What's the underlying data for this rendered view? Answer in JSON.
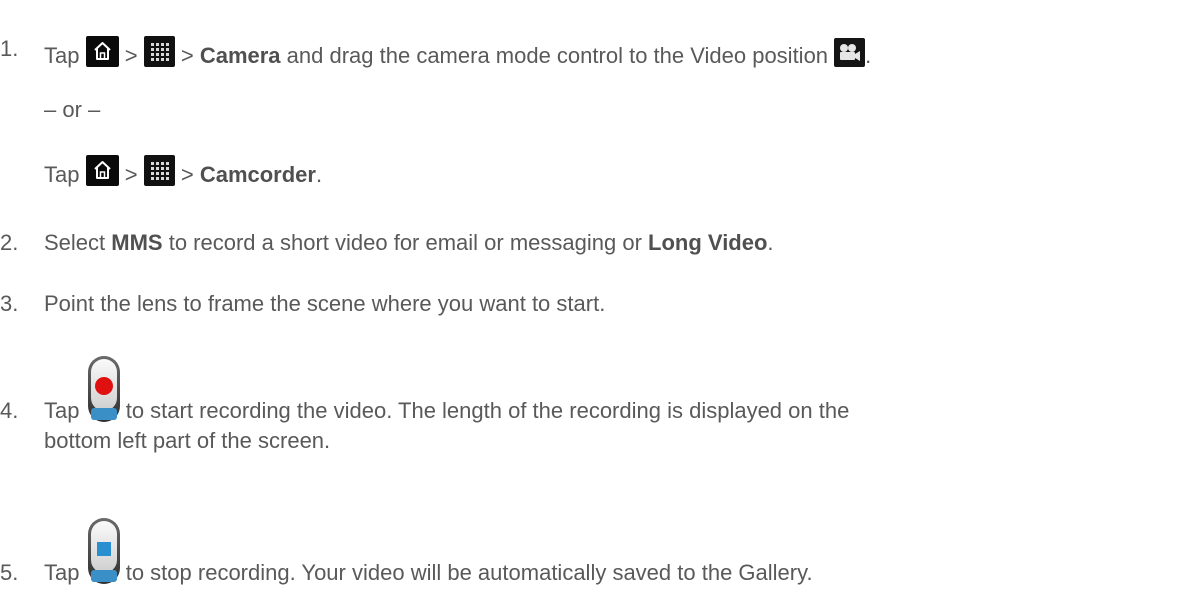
{
  "steps": [
    {
      "number": "1.",
      "t1": "Tap",
      "gt1": ">",
      "gt2": ">",
      "bold": "Camera",
      "t2": " and drag the camera mode control to the Video position",
      "end": "."
    },
    {
      "or": "– or –"
    },
    {
      "t1": "Tap",
      "gt1": ">",
      "gt2": ">",
      "bold": "Camcorder",
      "end": "."
    },
    {
      "number": "2.",
      "t1": "Select ",
      "bold1": "MMS",
      "t2": " to record a short video for email or messaging or ",
      "bold2": "Long Video",
      "end": "."
    },
    {
      "number": "3.",
      "t1": "Point the lens to frame the scene where you want to start."
    },
    {
      "number": "4.",
      "t1": "Tap",
      "t2": " to start recording the video. The length of the recording is displayed on the",
      "t3": "bottom left part of the screen."
    },
    {
      "number": "5.",
      "t1": "Tap",
      "t2": " to stop recording. Your video will be automatically saved to the Gallery."
    }
  ],
  "icons": {
    "home": "home-icon",
    "apps": "apps-grid-icon",
    "video": "video-camera-icon",
    "record": "record-button-icon",
    "stop": "stop-button-icon"
  },
  "colors": {
    "text": "#595959",
    "record_dot": "#e01010",
    "stop_square": "#2a8fd0"
  }
}
